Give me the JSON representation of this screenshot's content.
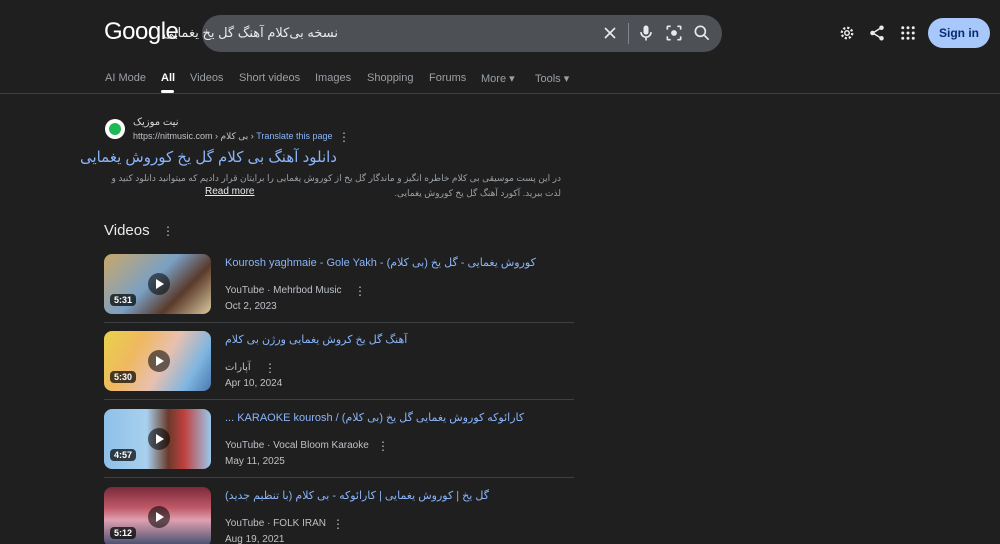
{
  "header": {
    "logo": "Google",
    "search_query": "نسخه بی‌کلام آهنگ گل یخ یغمایی",
    "sign_in": "Sign in"
  },
  "tabs": [
    {
      "label": "AI Mode"
    },
    {
      "label": "All",
      "active": true
    },
    {
      "label": "Videos"
    },
    {
      "label": "Short videos"
    },
    {
      "label": "Images"
    },
    {
      "label": "Shopping"
    },
    {
      "label": "Forums"
    },
    {
      "label": "More ▾"
    },
    {
      "label": "Tools ▾"
    }
  ],
  "result": {
    "site_name": "نیت موزیک",
    "url": "https://nitmusic.com › بی کلام › ",
    "translate": "Translate this page",
    "title": "دانلود آهنگ بی کلام گل یخ کوروش یغمایی",
    "snippet": "در این پست موسیقی بی کلام خاطره انگیز و ماندگار گل یخ از کوروش یغمایی را برایتان قرار دادیم که میتوانید دانلود کنید و لذت ببرید. آکورد آهنگ گل یخ کوروش یغمایی.",
    "read_more": "Read more"
  },
  "videos_section": {
    "heading": "Videos",
    "items": [
      {
        "title": "Kourosh yaghmaie - Gole Yakh - (کوروش یغمایی - گل یخ (بی کلام",
        "source": "YouTube · Mehrbod Music",
        "date": "Oct 2, 2023",
        "duration": "5:31"
      },
      {
        "title": "آهنگ گل یخ کروش یغمایی ورژن بی کلام",
        "source": "آپارات",
        "date": "Apr 10, 2024",
        "duration": "5:30"
      },
      {
        "title": "... KARAOKE kourosh / (کارائوکه کوروش یغمایی گل یخ (بی کلام",
        "source": "YouTube · Vocal Bloom Karaoke",
        "date": "May 11, 2025",
        "duration": "4:57"
      },
      {
        "title": "(با تنظیم جدید) گل یخ | کوروش یغمایی | کارائوکه - بی کلام",
        "source": "YouTube · FOLK IRAN",
        "date": "Aug 19, 2021",
        "duration": "5:12"
      }
    ]
  },
  "colors": {
    "background": "#1f1f1f",
    "link": "#8ab4f8",
    "signin_bg": "#a8c7fa"
  }
}
